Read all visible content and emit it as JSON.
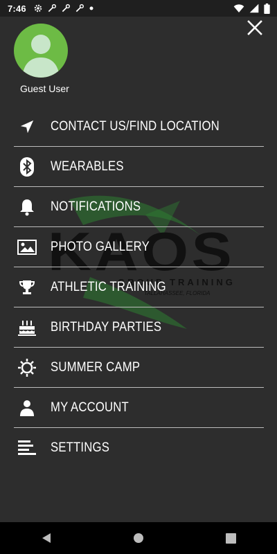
{
  "status_bar": {
    "time": "7:46",
    "icons": [
      "settings-icon",
      "wrench-icon",
      "wrench-icon",
      "wrench-icon",
      "dot-icon"
    ],
    "right_icons": [
      "wifi-icon",
      "signal-icon",
      "battery-icon"
    ]
  },
  "drawer": {
    "user": {
      "name": "Guest User"
    },
    "close_icon": "close-icon",
    "menu": [
      {
        "label": "CONTACT US/FIND LOCATION",
        "icon": "navigation-arrow-icon"
      },
      {
        "label": "WEARABLES",
        "icon": "bluetooth-icon"
      },
      {
        "label": "NOTIFICATIONS",
        "icon": "bell-icon"
      },
      {
        "label": "PHOTO GALLERY",
        "icon": "image-icon"
      },
      {
        "label": "ATHLETIC TRAINING",
        "icon": "trophy-icon"
      },
      {
        "label": "BIRTHDAY PARTIES",
        "icon": "cake-icon"
      },
      {
        "label": "SUMMER CAMP",
        "icon": "sun-icon"
      },
      {
        "label": "MY ACCOUNT",
        "icon": "person-icon"
      },
      {
        "label": "SETTINGS",
        "icon": "settings-lines-icon"
      }
    ]
  },
  "watermark": {
    "brand": "KAOS",
    "tagline": "GROUP TRAINING",
    "location": "TALLAHASSEE, FLORIDA"
  },
  "nav_bar": {
    "icons": [
      "back-icon",
      "home-icon",
      "recents-icon"
    ]
  },
  "colors": {
    "background": "#2d2d2d",
    "avatar": "#6dbb45",
    "divider": "#bdbdbd",
    "watermark_green": "#2e7d32"
  }
}
